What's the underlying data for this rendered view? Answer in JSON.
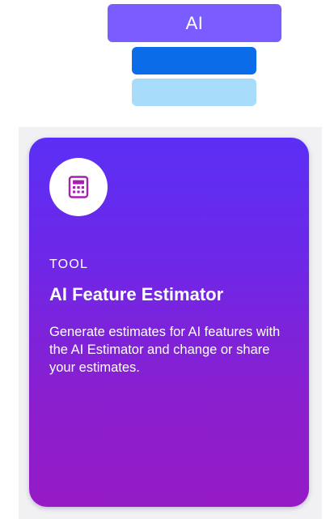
{
  "header": {
    "ai_label": "AI"
  },
  "colors": {
    "ai_bar": "#7b5cff",
    "stack_bar_1": "#0a6ce8",
    "stack_bar_2": "#a7dcfb",
    "card_gradient_top": "#5b2ff6",
    "card_gradient_bottom": "#951bc6",
    "icon_accent": "#a61fb3"
  },
  "card": {
    "icon": "calculator-icon",
    "category": "TOOL",
    "title": "AI Feature Estimator",
    "description": "Generate estimates for AI features with the AI Estimator and change or share your estimates."
  }
}
